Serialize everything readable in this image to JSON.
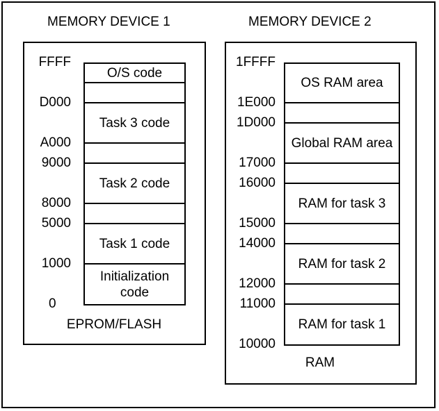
{
  "device1": {
    "title": "MEMORY DEVICE 1",
    "caption": "EPROM/FLASH",
    "rows": [
      "O/S code",
      "",
      "Task 3 code",
      "",
      "Task 2 code",
      "",
      "Task 1 code",
      "Initialization code"
    ],
    "addresses": [
      "FFFF",
      "D000",
      "A000",
      "9000",
      "8000",
      "5000",
      "1000",
      "0"
    ]
  },
  "device2": {
    "title": "MEMORY DEVICE 2",
    "caption": "RAM",
    "rows": [
      "OS RAM area",
      "",
      "Global RAM area",
      "",
      "RAM for task 3",
      "",
      "RAM for task 2",
      "",
      "RAM for task 1"
    ],
    "addresses": [
      "1FFFF",
      "1E000",
      "1D000",
      "17000",
      "16000",
      "15000",
      "14000",
      "12000",
      "11000",
      "10000"
    ]
  }
}
